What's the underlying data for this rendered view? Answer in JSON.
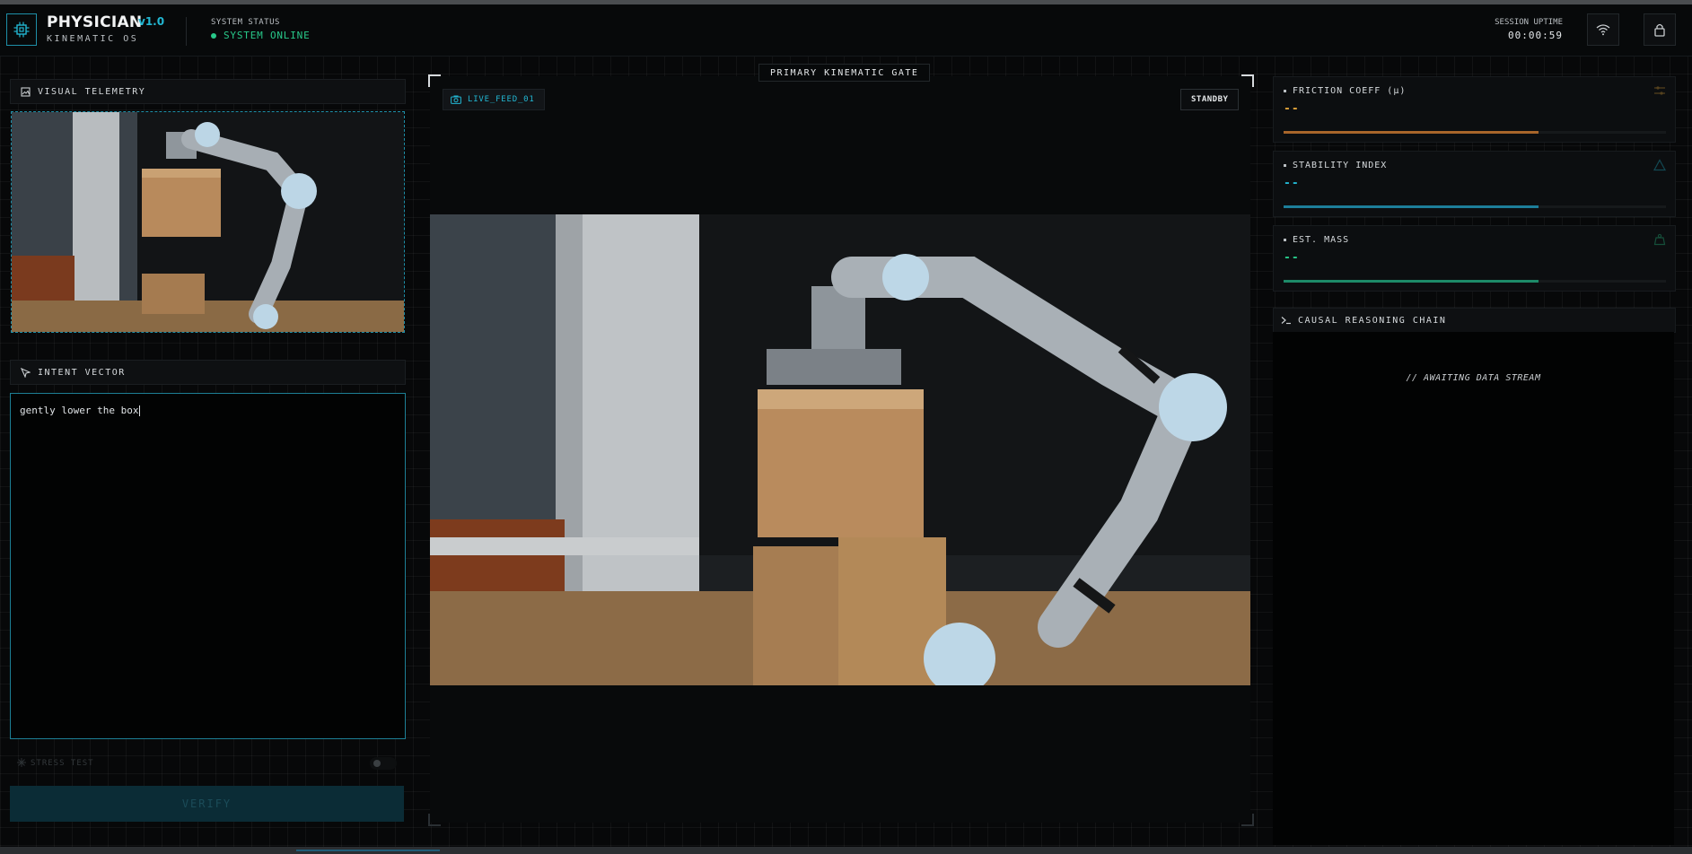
{
  "app": {
    "title": "PHYSICIAN",
    "version": "v1.0",
    "subtitle": "KINEMATIC OS"
  },
  "status": {
    "label": "SYSTEM STATUS",
    "value": "SYSTEM ONLINE",
    "color": "#28c98a"
  },
  "session": {
    "label": "SESSION UPTIME",
    "value": "00:00:59"
  },
  "header_icons": [
    "chip-icon",
    "wifi-icon",
    "lock-icon"
  ],
  "left": {
    "telemetry_title": "VISUAL TELEMETRY",
    "intent_title": "INTENT VECTOR",
    "intent_text": "gently lower the box",
    "stress_label": "STRESS TEST",
    "verify_label": "VERIFY"
  },
  "center": {
    "gate_label": "PRIMARY KINEMATIC GATE",
    "feed_label": "LIVE_FEED_01",
    "mode_label": "STANDBY"
  },
  "metrics": [
    {
      "label": "FRICTION COEFF (μ)",
      "value": "--",
      "color": "#e0a33a",
      "bar_color": "#a8652a",
      "fill_fraction": 0.667,
      "icon": "sliders-icon"
    },
    {
      "label": "STABILITY INDEX",
      "value": "--",
      "color": "#22b7d3",
      "bar_color": "#1d7e9a",
      "fill_fraction": 0.667,
      "icon": "triangle-icon"
    },
    {
      "label": "EST. MASS",
      "value": "--",
      "color": "#28c98a",
      "bar_color": "#1d8a68",
      "fill_fraction": 0.667,
      "icon": "weight-icon"
    }
  ],
  "causal": {
    "title": "CAUSAL REASONING CHAIN",
    "placeholder": "// AWAITING DATA STREAM"
  },
  "accent": "#22b7d3"
}
